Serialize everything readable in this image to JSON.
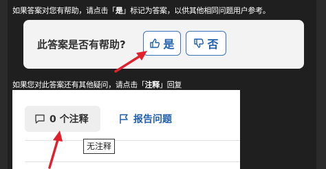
{
  "instructions": {
    "line1_before": "如果答案对您有帮助，请点击「",
    "line1_bold": "是",
    "line1_after": "」标记为答案，以供其他相同问题用户参考。",
    "line2_before": "如果您对此答案还有其他疑问，请点击「",
    "line2_bold": "注释",
    "line2_after": "」回复"
  },
  "helpful_prompt": {
    "question": "此答案是否有帮助?",
    "yes_label": "是",
    "no_label": "否",
    "yes_icon": "thumbs-up-icon",
    "no_icon": "thumbs-down-icon"
  },
  "actions": {
    "comments_label": "0 个注释",
    "comments_icon": "comment-icon",
    "report_label": "报告问题",
    "report_icon": "flag-icon",
    "tooltip": "无注释"
  },
  "colors": {
    "accent": "#1f5fb0",
    "arrow": "#e0212b"
  }
}
